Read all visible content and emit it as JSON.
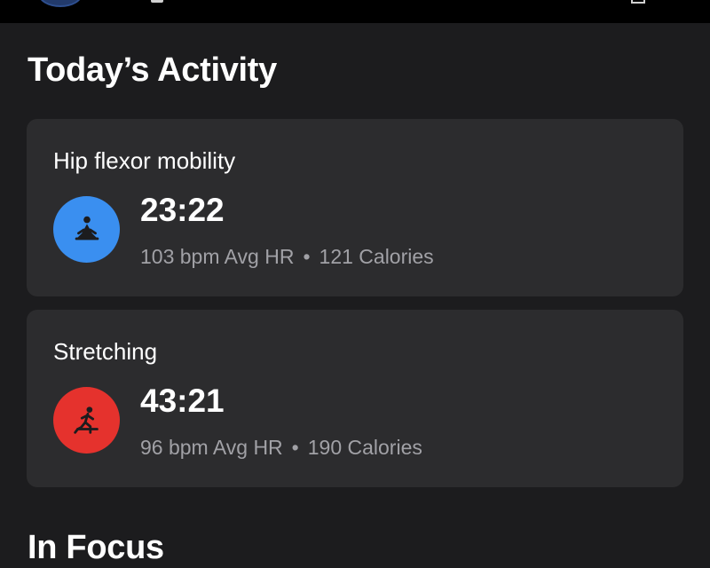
{
  "colors": {
    "background": "#1c1c1e",
    "card": "#2c2c2e",
    "secondary_text": "#a1a1a6",
    "yoga_icon_bg": "#3a8ff0",
    "stretching_icon_bg": "#e5322d"
  },
  "sections": {
    "today_title": "Today’s Activity",
    "in_focus_title": "In Focus"
  },
  "activities": [
    {
      "title": "Hip flexor mobility",
      "duration": "23:22",
      "heart_rate": "103 bpm Avg HR",
      "separator": "•",
      "calories": "121 Calories",
      "icon": "yoga-icon"
    },
    {
      "title": "Stretching",
      "duration": "43:21",
      "heart_rate": "96 bpm Avg HR",
      "separator": "•",
      "calories": "190 Calories",
      "icon": "stretching-figure-icon"
    }
  ]
}
